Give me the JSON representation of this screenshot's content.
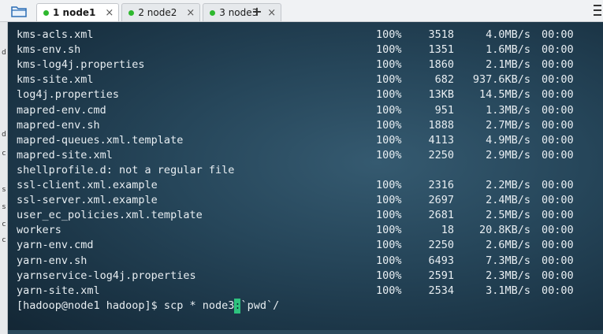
{
  "tabs": [
    {
      "label": "1 node1",
      "dot_color": "#2eb82e",
      "active": true
    },
    {
      "label": "2 node2",
      "dot_color": "#2eb82e",
      "active": false
    },
    {
      "label": "3 node3",
      "dot_color": "#2eb82e",
      "active": false
    }
  ],
  "tab_close_glyph": "×",
  "add_tab_glyph": "+",
  "left_strip_fragments": [
    "d",
    "d",
    "c",
    "s",
    "s",
    "c",
    "c"
  ],
  "transfers": [
    {
      "name": "kms-acls.xml",
      "pct": "100%",
      "size": "3518",
      "rate": "4.0MB/s",
      "time": "00:00"
    },
    {
      "name": "kms-env.sh",
      "pct": "100%",
      "size": "1351",
      "rate": "1.6MB/s",
      "time": "00:00"
    },
    {
      "name": "kms-log4j.properties",
      "pct": "100%",
      "size": "1860",
      "rate": "2.1MB/s",
      "time": "00:00"
    },
    {
      "name": "kms-site.xml",
      "pct": "100%",
      "size": "682",
      "rate": "937.6KB/s",
      "time": "00:00"
    },
    {
      "name": "log4j.properties",
      "pct": "100%",
      "size": "13KB",
      "rate": "14.5MB/s",
      "time": "00:00"
    },
    {
      "name": "mapred-env.cmd",
      "pct": "100%",
      "size": "951",
      "rate": "1.3MB/s",
      "time": "00:00"
    },
    {
      "name": "mapred-env.sh",
      "pct": "100%",
      "size": "1888",
      "rate": "2.7MB/s",
      "time": "00:00"
    },
    {
      "name": "mapred-queues.xml.template",
      "pct": "100%",
      "size": "4113",
      "rate": "4.9MB/s",
      "time": "00:00"
    },
    {
      "name": "mapred-site.xml",
      "pct": "100%",
      "size": "2250",
      "rate": "2.9MB/s",
      "time": "00:00"
    },
    {
      "message": "shellprofile.d: not a regular file"
    },
    {
      "name": "ssl-client.xml.example",
      "pct": "100%",
      "size": "2316",
      "rate": "2.2MB/s",
      "time": "00:00"
    },
    {
      "name": "ssl-server.xml.example",
      "pct": "100%",
      "size": "2697",
      "rate": "2.4MB/s",
      "time": "00:00"
    },
    {
      "name": "user_ec_policies.xml.template",
      "pct": "100%",
      "size": "2681",
      "rate": "2.5MB/s",
      "time": "00:00"
    },
    {
      "name": "workers",
      "pct": "100%",
      "size": "18",
      "rate": "20.8KB/s",
      "time": "00:00"
    },
    {
      "name": "yarn-env.cmd",
      "pct": "100%",
      "size": "2250",
      "rate": "2.6MB/s",
      "time": "00:00"
    },
    {
      "name": "yarn-env.sh",
      "pct": "100%",
      "size": "6493",
      "rate": "7.3MB/s",
      "time": "00:00"
    },
    {
      "name": "yarnservice-log4j.properties",
      "pct": "100%",
      "size": "2591",
      "rate": "2.3MB/s",
      "time": "00:00"
    },
    {
      "name": "yarn-site.xml",
      "pct": "100%",
      "size": "2534",
      "rate": "3.1MB/s",
      "time": "00:00"
    }
  ],
  "prompt": {
    "before_cursor": "[hadoop@node1 hadoop]$ scp * node3",
    "cursor_char": ":",
    "after_cursor": "`pwd`/"
  },
  "colors": {
    "terminal_text": "#e8eef2",
    "cursor": "#2ec27e",
    "tab_dot": "#2eb82e"
  }
}
